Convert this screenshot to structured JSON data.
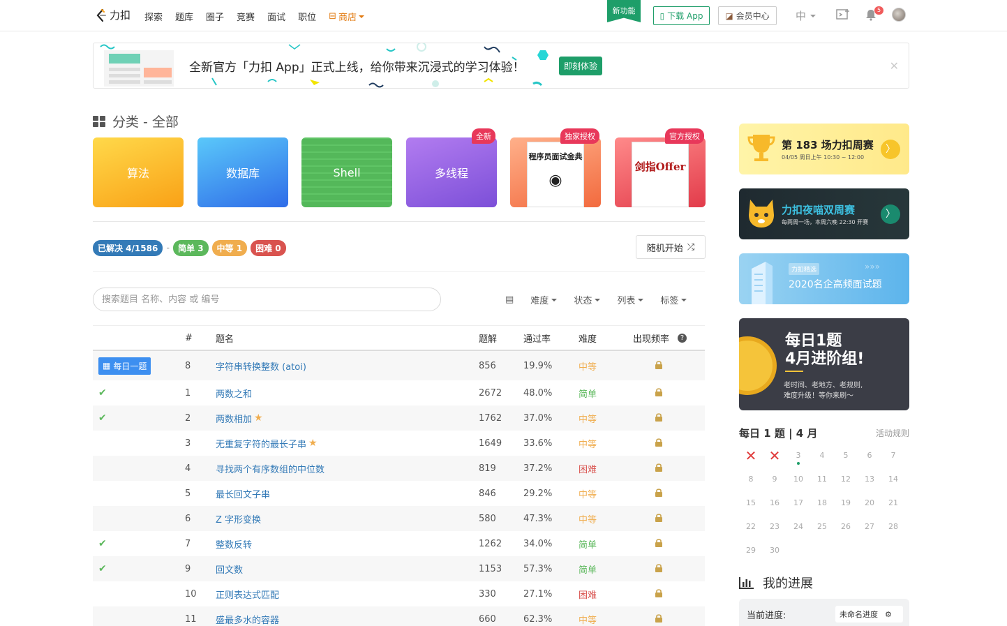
{
  "nav": {
    "logo": "力扣",
    "links": [
      "探索",
      "题库",
      "圈子",
      "竞赛",
      "面试",
      "职位"
    ],
    "store": "商店",
    "new_feature": "新功能",
    "download_app": "下载 App",
    "vip": "会员中心",
    "lang": "中",
    "notif_count": "5"
  },
  "banner": {
    "text": "全新官方「力扣 App」正式上线，给你带来沉浸式的学习体验！",
    "button": "即刻体验",
    "close": "✕"
  },
  "category": {
    "title": "分类 - 全部",
    "cards": [
      {
        "label": "算法",
        "tag": ""
      },
      {
        "label": "数据库",
        "tag": ""
      },
      {
        "label": "Shell",
        "tag": ""
      },
      {
        "label": "多线程",
        "tag": "全新"
      },
      {
        "label": "",
        "tag": "独家授权",
        "book": "程序员面试金典"
      },
      {
        "label": "",
        "tag": "官方授权",
        "book": "剑指Offer"
      }
    ]
  },
  "stats": {
    "solved": "已解决 4/1586",
    "dash": "-",
    "easy": "简单 3",
    "medium": "中等 1",
    "hard": "困难 0",
    "random": "随机开始"
  },
  "search": {
    "placeholder": "搜索题目 名称、内容 或 编号"
  },
  "filters": [
    "难度",
    "状态",
    "列表",
    "标签"
  ],
  "table": {
    "headers": {
      "num": "#",
      "title": "题名",
      "solutions": "题解",
      "rate": "通过率",
      "difficulty": "难度",
      "freq": "出现频率"
    },
    "daily_label": "每日一题",
    "rows": [
      {
        "status": "daily",
        "num": "8",
        "title": "字符串转换整数 (atoi)",
        "star": false,
        "solutions": "856",
        "rate": "19.9%",
        "difficulty": "中等"
      },
      {
        "status": "solved",
        "num": "1",
        "title": "两数之和",
        "star": false,
        "solutions": "2672",
        "rate": "48.0%",
        "difficulty": "简单"
      },
      {
        "status": "solved",
        "num": "2",
        "title": "两数相加",
        "star": true,
        "solutions": "1762",
        "rate": "37.0%",
        "difficulty": "中等"
      },
      {
        "status": "",
        "num": "3",
        "title": "无重复字符的最长子串",
        "star": true,
        "solutions": "1649",
        "rate": "33.6%",
        "difficulty": "中等"
      },
      {
        "status": "",
        "num": "4",
        "title": "寻找两个有序数组的中位数",
        "star": false,
        "solutions": "819",
        "rate": "37.2%",
        "difficulty": "困难"
      },
      {
        "status": "",
        "num": "5",
        "title": "最长回文子串",
        "star": false,
        "solutions": "846",
        "rate": "29.2%",
        "difficulty": "中等"
      },
      {
        "status": "",
        "num": "6",
        "title": "Z 字形变换",
        "star": false,
        "solutions": "580",
        "rate": "47.3%",
        "difficulty": "中等"
      },
      {
        "status": "solved",
        "num": "7",
        "title": "整数反转",
        "star": false,
        "solutions": "1262",
        "rate": "34.0%",
        "difficulty": "简单"
      },
      {
        "status": "solved",
        "num": "9",
        "title": "回文数",
        "star": false,
        "solutions": "1153",
        "rate": "57.3%",
        "difficulty": "简单"
      },
      {
        "status": "",
        "num": "10",
        "title": "正则表达式匹配",
        "star": false,
        "solutions": "330",
        "rate": "27.1%",
        "difficulty": "困难"
      },
      {
        "status": "",
        "num": "11",
        "title": "盛最多水的容器",
        "star": false,
        "solutions": "660",
        "rate": "62.3%",
        "difficulty": "中等"
      }
    ]
  },
  "promos": {
    "weekly_title": "第 183 场力扣周赛",
    "weekly_time": "04/05 周日上午 10:30 ~ 12:00",
    "biweekly_title": "力扣夜喵双周赛",
    "biweekly_sub": "每两周一场，本周六晚 22:30 开赛",
    "select_tag": "力扣精选",
    "select_title": "2020名企高频面试题",
    "daily_title_1": "每日1题",
    "daily_title_2": "4月进阶组!",
    "daily_sub_1": "老时间、老地方、老规则,",
    "daily_sub_2": "难度升级！等你来刷～"
  },
  "calendar": {
    "title": "每日 1 题 | 4 月",
    "rules": "活动规则",
    "days": [
      "✕",
      "✕",
      "3",
      "4",
      "5",
      "6",
      "7",
      "8",
      "9",
      "10",
      "11",
      "12",
      "13",
      "14",
      "15",
      "16",
      "17",
      "18",
      "19",
      "20",
      "21",
      "22",
      "23",
      "24",
      "25",
      "26",
      "27",
      "28",
      "29",
      "30"
    ]
  },
  "progress": {
    "title": "我的进展",
    "current": "当前进度:",
    "select": "未命名进度"
  },
  "colors": {
    "brand": "#1e9e69",
    "link": "#337ab7",
    "easy": "#5cb85c",
    "medium": "#f0ad4e",
    "hard": "#d9534f"
  }
}
